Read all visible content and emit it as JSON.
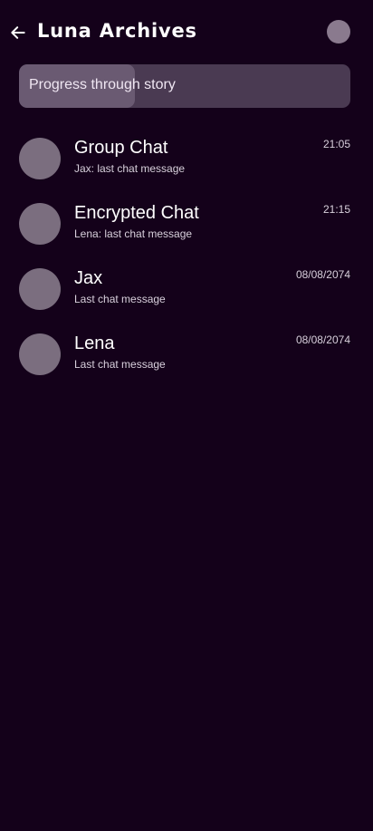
{
  "header": {
    "title": "Luna Archives",
    "back_icon": "arrow-left-icon",
    "avatar": "profile-avatar"
  },
  "progress": {
    "label": "Progress through story",
    "fraction": 0.35
  },
  "chats": [
    {
      "name": "Group Chat",
      "preview": "Jax: last chat message",
      "time": "21:05"
    },
    {
      "name": "Encrypted Chat",
      "preview": "Lena: last chat message",
      "time": "21:15"
    },
    {
      "name": "Jax",
      "preview": "Last chat message",
      "time": "08/08/2074"
    },
    {
      "name": "Lena",
      "preview": "Last chat message",
      "time": "08/08/2074"
    }
  ],
  "colors": {
    "background": "#14011a",
    "progress_track": "#4a3a52",
    "progress_fill": "#6a5a72",
    "avatar": "#7b6e7f"
  }
}
